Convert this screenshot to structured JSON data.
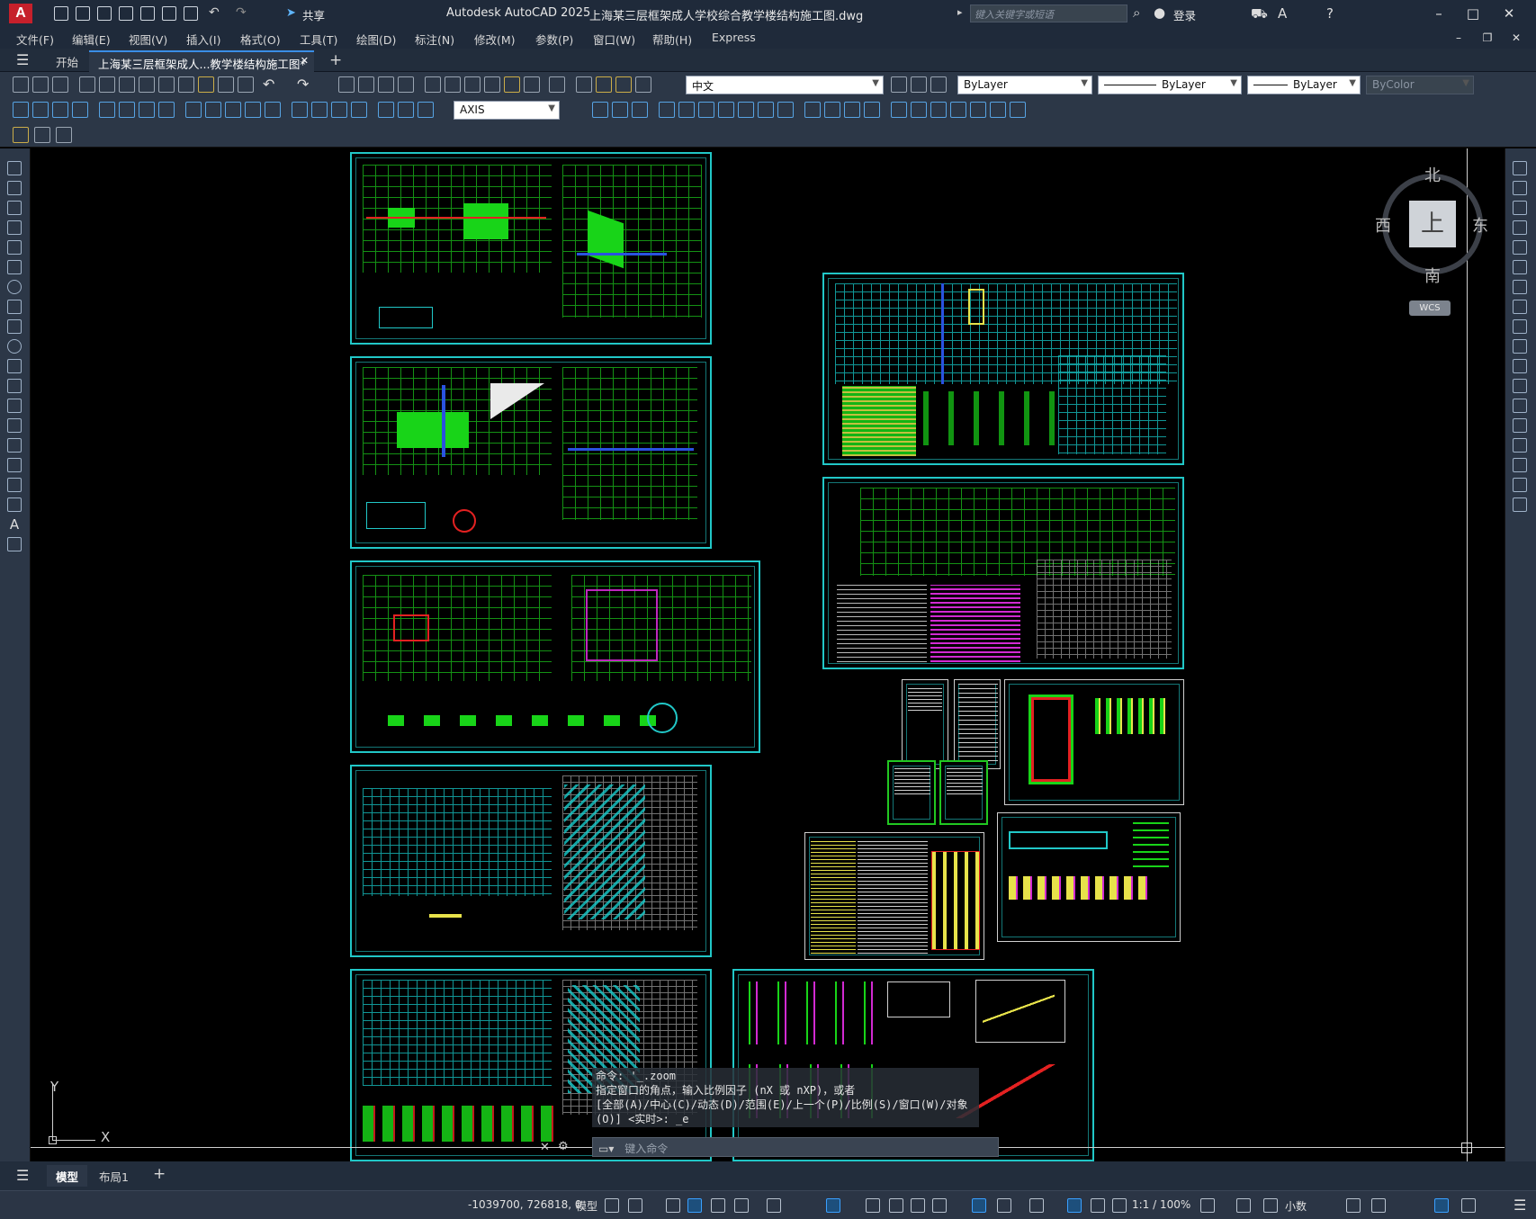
{
  "app": {
    "title": "Autodesk AutoCAD 2025",
    "document": "上海某三层框架成人学校综合教学楼结构施工图.dwg",
    "logo_letter": "A",
    "share_label": "共享",
    "search_placeholder": "键入关键字或短语",
    "login_label": "登录"
  },
  "menu": [
    "文件(F)",
    "编辑(E)",
    "视图(V)",
    "插入(I)",
    "格式(O)",
    "工具(T)",
    "绘图(D)",
    "标注(N)",
    "修改(M)",
    "参数(P)",
    "窗口(W)",
    "帮助(H)",
    "Express"
  ],
  "tabs": {
    "start": "开始",
    "drawing": "上海某三层框架成人...教学楼结构施工图*",
    "add": "+"
  },
  "toolbar": {
    "language": "中文",
    "layer": "ByLayer",
    "linetype": "ByLayer",
    "lineweight": "ByLayer",
    "color": "ByColor",
    "dimstyle": "AXIS"
  },
  "viewcube": {
    "north": "北",
    "south": "南",
    "east": "东",
    "west": "西",
    "face": "上",
    "wcs": "WCS"
  },
  "ucs": {
    "x_label": "X",
    "y_label": "Y"
  },
  "command": {
    "lines": [
      "命令: '_.zoom",
      "指定窗口的角点，输入比例因子 (nX 或 nXP)，或者",
      "[全部(A)/中心(C)/动态(D)/范围(E)/上一个(P)/比例(S)/窗口(W)/对象",
      "(O)] <实时>: _e"
    ],
    "input_placeholder": "键入命令"
  },
  "layout_tabs": {
    "model": "模型",
    "layout1": "布局1",
    "add": "+"
  },
  "status": {
    "coords": "-1039700, 726818, 0",
    "model": "模型",
    "scale": "1:1 / 100%",
    "units": "小数"
  },
  "colors": {
    "accent": "#3a8ee6",
    "frame_cyan": "#21c7c7",
    "drawing_green": "#21c821",
    "brand_red": "#c6202b"
  }
}
